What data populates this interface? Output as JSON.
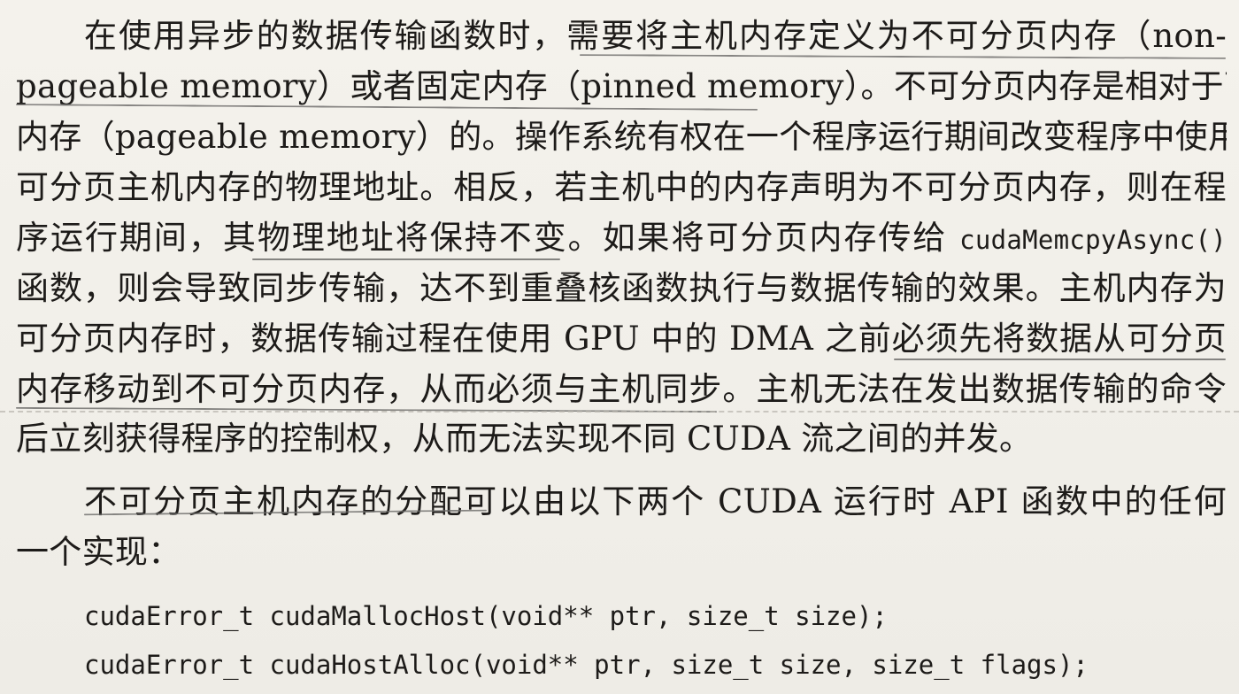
{
  "paragraph1": {
    "lines": [
      "在使用异步的数据传输函数时，需要将主机内存定义为不可分页内存（non-",
      "pageable memory）或者固定内存（pinned memory）。不可分页内存是相对于可分页",
      "内存（pageable memory）的。操作系统有权在一个程序运行期间改变程序中使用的",
      "可分页主机内存的物理地址。相反，若主机中的内存声明为不可分页内存，则在程",
      "序运行期间，其物理地址将保持不变。如果将可分页内存传给",
      "函数，则会导致同步传输，达不到重叠核函数执行与数据传输的效果。主机内存为",
      "可分页内存时，数据传输过程在使用 GPU 中的 DMA 之前必须先将数据从可分页",
      "内存移动到不可分页内存，从而必须与主机同步。主机无法在发出数据传输的命令",
      "后立刻获得程序的控制权，从而无法实现不同 CUDA 流之间的并发。"
    ],
    "inline_code": "cudaMemcpyAsync()"
  },
  "paragraph2": {
    "lines": [
      "不可分页主机内存的分配可以由以下两个 CUDA 运行时 API 函数中的任何",
      "一个实现："
    ]
  },
  "code": [
    "cudaError_t cudaMallocHost(void** ptr, size_t size);",
    "cudaError_t cudaHostAlloc(void** ptr, size_t size, size_t flags);"
  ]
}
